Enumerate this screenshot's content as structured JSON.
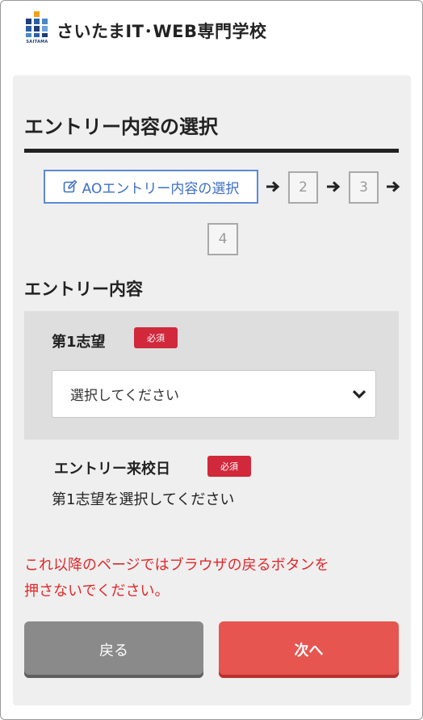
{
  "header": {
    "logo_sub": "SAITAMA",
    "site_name": "さいたまIT･WEB専門学校"
  },
  "page": {
    "section_title": "エントリー内容の選択"
  },
  "steps": [
    {
      "label": "AOエントリー内容の選択",
      "icon": "edit-icon",
      "active": true
    },
    {
      "label": "2",
      "active": false
    },
    {
      "label": "3",
      "active": false
    },
    {
      "label": "4",
      "active": false
    }
  ],
  "entry": {
    "title": "エントリー内容",
    "choice_label": "第1志望",
    "required_badge": "必須",
    "choice_select_value": "選択してください",
    "date_label": "エントリー来校日",
    "date_required_badge": "必須",
    "date_message": "第1志望を選択してください"
  },
  "warning": {
    "line1": "これ以降のページではブラウザの戻るボタンを",
    "line2": "押さないでください。"
  },
  "buttons": {
    "back": "戻る",
    "next": "次へ"
  },
  "colors": {
    "accent_blue": "#5b8ad8",
    "required_red": "#d1283c",
    "warning_red": "#e0292b",
    "next_button": "#e65550",
    "back_button": "#8a8a8a"
  }
}
